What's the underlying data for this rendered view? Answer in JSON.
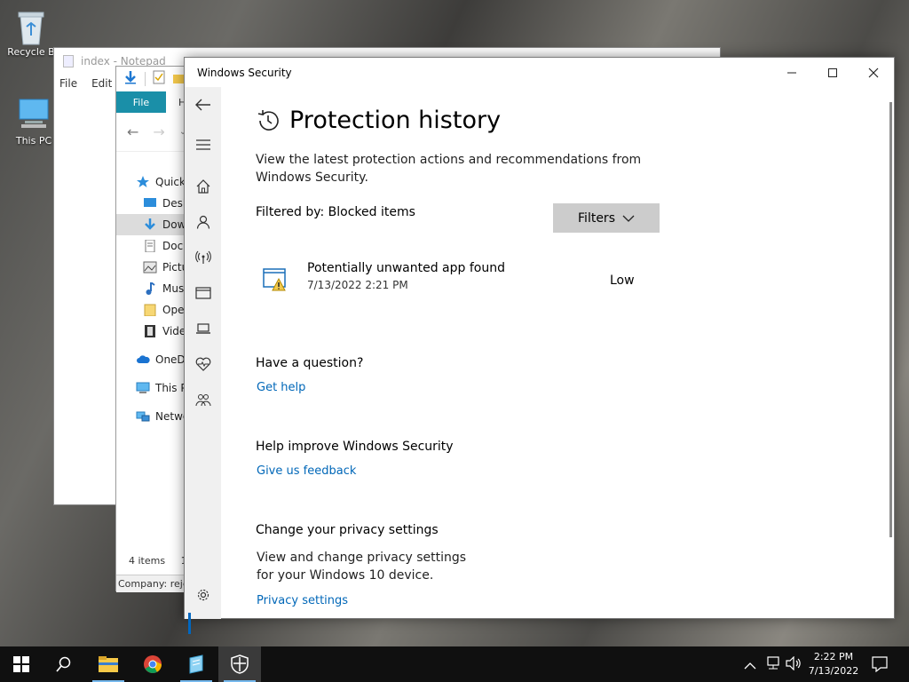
{
  "desktop": {
    "icons": [
      {
        "label": "Recycle B",
        "icon": "recycle-bin-icon"
      },
      {
        "label": "This PC",
        "icon": "computer-icon"
      }
    ]
  },
  "notepad": {
    "title": "index - Notepad",
    "menu": [
      "File",
      "Edit"
    ]
  },
  "explorer": {
    "ribbon_file": "File",
    "ribbon_home": "H",
    "tree": [
      {
        "label": "Quick",
        "icon": "star-icon"
      },
      {
        "label": "Desk",
        "icon": "desktop-folder-icon"
      },
      {
        "label": "Dow",
        "icon": "download-icon"
      },
      {
        "label": "Docu",
        "icon": "document-icon"
      },
      {
        "label": "Pictu",
        "icon": "pictures-icon"
      },
      {
        "label": "Musi",
        "icon": "music-icon"
      },
      {
        "label": "Oper",
        "icon": "folder-icon"
      },
      {
        "label": "Vide",
        "icon": "video-icon"
      },
      {
        "label": "OneDr",
        "icon": "cloud-icon"
      },
      {
        "label": "This P",
        "icon": "computer-icon"
      },
      {
        "label": "Netwo",
        "icon": "network-icon"
      }
    ],
    "status": "4 items",
    "status_extra": "1",
    "company": "Company: reje"
  },
  "winsec": {
    "window_title": "Windows Security",
    "page_title": "Protection history",
    "description": "View the latest protection actions and recommendations from Windows Security.",
    "filtered_by": "Filtered by: Blocked items",
    "filters_label": "Filters",
    "item": {
      "title": "Potentially unwanted app found",
      "date": "7/13/2022 2:21 PM",
      "severity": "Low"
    },
    "question_heading": "Have a question?",
    "get_help": "Get help",
    "improve_heading": "Help improve Windows Security",
    "feedback_link": "Give us feedback",
    "privacy_heading": "Change your privacy settings",
    "privacy_desc": "View and change privacy settings for your Windows 10 device.",
    "privacy_link": "Privacy settings"
  },
  "taskbar": {
    "time": "2:22 PM",
    "date": "7/13/2022"
  },
  "colors": {
    "accent": "#0067b8",
    "ribbon_file": "#1a8fa8",
    "taskbar": "#101010"
  }
}
